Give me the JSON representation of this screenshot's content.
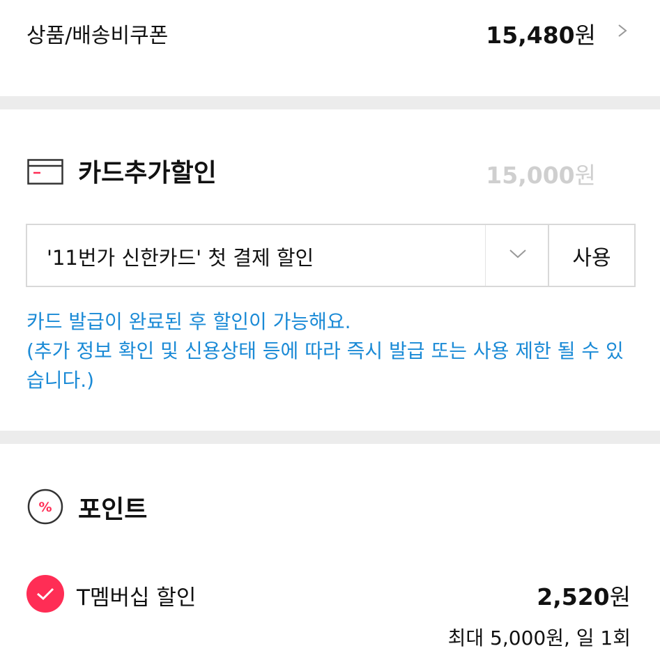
{
  "coupon": {
    "label": "상품/배송비쿠폰",
    "amount": "15,480",
    "currency": "원"
  },
  "card_discount": {
    "title": "카드추가할인",
    "amount": "15,000",
    "currency": "원",
    "select_value": "'11번가 신한카드' 첫 결제 할인",
    "use_button": "사용",
    "notice_line1": "카드 발급이 완료된 후 할인이 가능해요.",
    "notice_line2": "(추가 정보 확인 및 신용상태 등에 따라 즉시 발급 또는 사용 제한 될 수 있습니다.)"
  },
  "points": {
    "title": "포인트",
    "icon_symbol": "%",
    "tmember": {
      "label": "T멤버십 할인",
      "checked": true,
      "amount": "2,520",
      "currency": "원",
      "limit": "최대 5,000원, 일 1회"
    }
  },
  "colors": {
    "accent": "#ff2d55",
    "notice_blue": "#1a8ad6",
    "divider": "#ececec",
    "muted_amount": "#cfcfcf"
  }
}
